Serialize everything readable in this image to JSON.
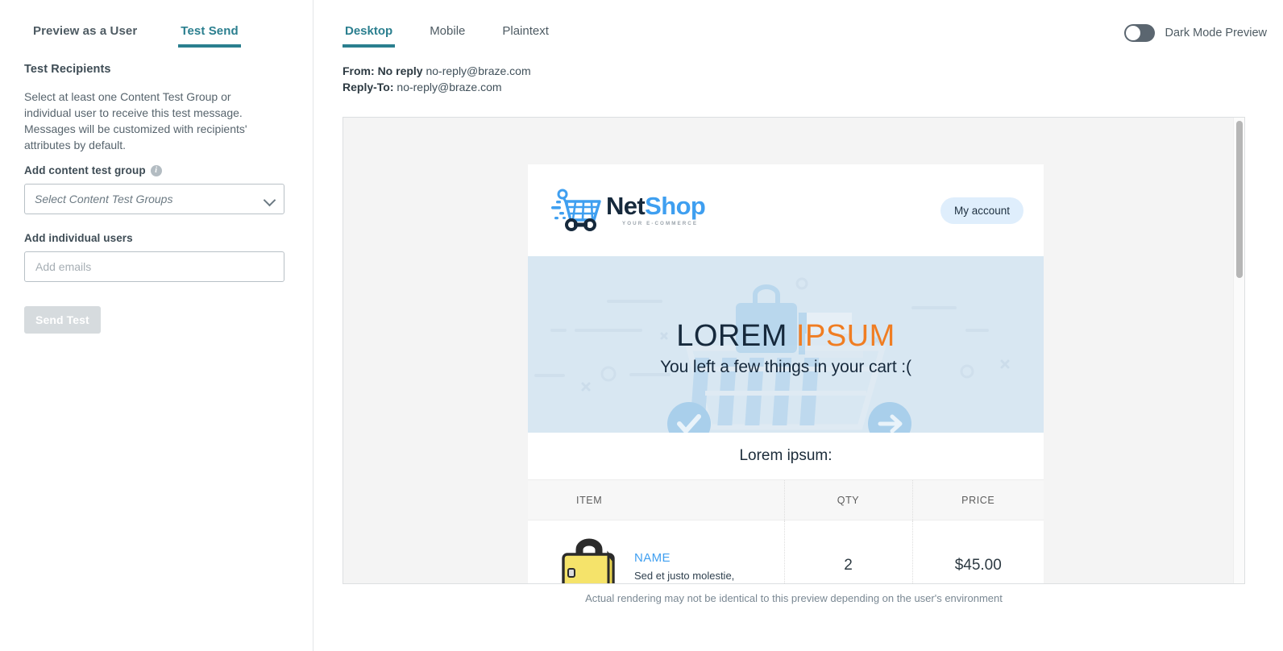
{
  "left_panel": {
    "tabs": [
      {
        "label": "Preview as a User",
        "active": false
      },
      {
        "label": "Test Send",
        "active": true
      }
    ],
    "section_title": "Test Recipients",
    "description": "Select at least one Content Test Group or individual user to receive this test message. Messages will be customized with recipients' attributes by default.",
    "content_test_group": {
      "label": "Add content test group",
      "info_icon": "info-icon",
      "info_glyph": "i",
      "select_placeholder": "Select Content Test Groups",
      "chevron_icon": "chevron-down-icon"
    },
    "individual_users": {
      "label": "Add individual users",
      "input_placeholder": "Add emails",
      "input_value": ""
    },
    "send_button": "Send Test"
  },
  "preview": {
    "tabs": [
      {
        "label": "Desktop",
        "active": true
      },
      {
        "label": "Mobile",
        "active": false
      },
      {
        "label": "Plaintext",
        "active": false
      }
    ],
    "dark_mode": {
      "label": "Dark Mode Preview",
      "state": "off",
      "toggle_icon": "toggle-switch-icon"
    },
    "meta": {
      "from_label": "From:",
      "from_name": "No reply",
      "from_email": "no-reply@braze.com",
      "reply_label": "Reply-To:",
      "reply_email": "no-reply@braze.com"
    },
    "scrollbar": {
      "name": "vertical-scrollbar"
    },
    "disclaimer": "Actual rendering may not be identical to this preview depending on the user's environment"
  },
  "email": {
    "brand": {
      "logo_icon": "shopping-cart-logo-icon",
      "name_part1": "Net",
      "name_part2": "Shop",
      "tagline": "YOUR E-COMMERCE"
    },
    "account_button": "My account",
    "hero": {
      "title_part1": "LOREM",
      "title_part2": "IPSUM",
      "subtitle": "You left a few things in your cart :(",
      "background_color": "#d8e7f2",
      "check_icon": "check-circle-icon",
      "arrow_icon": "arrow-right-circle-icon",
      "cart_icon": "cart-illustration-icon"
    },
    "section_heading": "Lorem ipsum:",
    "table": {
      "columns": [
        "ITEM",
        "QTY",
        "PRICE"
      ],
      "rows": [
        {
          "product_image": "yellow-bag-image",
          "name": "NAME",
          "description": "Sed et justo molestie,",
          "qty": "2",
          "price": "$45.00"
        }
      ]
    }
  },
  "colors": {
    "accent_teal": "#2b7f8f",
    "brand_blue": "#3f9ff0",
    "brand_navy": "#16293c",
    "hero_orange": "#f07d22"
  }
}
